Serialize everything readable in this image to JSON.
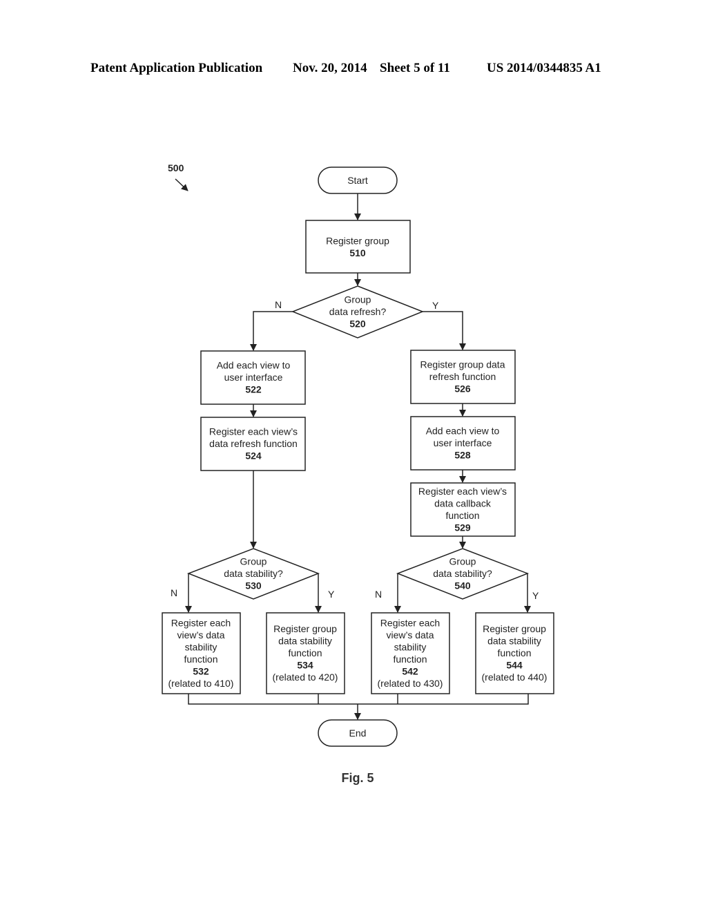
{
  "header": {
    "publication": "Patent Application Publication",
    "date": "Nov. 20, 2014",
    "sheet": "Sheet 5 of 11",
    "number": "US 2014/0344835 A1"
  },
  "diagram": {
    "ref_label": "500",
    "figure_caption": "Fig. 5",
    "start": "Start",
    "end": "End",
    "nodes": {
      "n510": {
        "lines": [
          "Register group"
        ],
        "num": "510"
      },
      "n520": {
        "lines": [
          "Group",
          "data refresh?"
        ],
        "num": "520"
      },
      "n522": {
        "lines": [
          "Add each view to",
          "user interface"
        ],
        "num": "522"
      },
      "n524": {
        "lines": [
          "Register each view’s",
          "data refresh function"
        ],
        "num": "524"
      },
      "n526": {
        "lines": [
          "Register group data",
          "refresh function"
        ],
        "num": "526"
      },
      "n528": {
        "lines": [
          "Add each view to",
          "user interface"
        ],
        "num": "528"
      },
      "n529": {
        "lines": [
          "Register each view’s",
          "data callback",
          "function"
        ],
        "num": "529"
      },
      "n530": {
        "lines": [
          "Group",
          "data stability?"
        ],
        "num": "530"
      },
      "n540": {
        "lines": [
          "Group",
          "data stability?"
        ],
        "num": "540"
      },
      "n532": {
        "lines": [
          "Register each",
          "view’s data",
          "stability",
          "function"
        ],
        "num": "532",
        "note": "(related to 410)"
      },
      "n534": {
        "lines": [
          "Register group",
          "data stability",
          "function"
        ],
        "num": "534",
        "note": "(related to 420)"
      },
      "n542": {
        "lines": [
          "Register each",
          "view’s data",
          "stability",
          "function"
        ],
        "num": "542",
        "note": "(related to 430)"
      },
      "n544": {
        "lines": [
          "Register group",
          "data stability",
          "function"
        ],
        "num": "544",
        "note": "(related to 440)"
      }
    },
    "branch_labels": {
      "no": "N",
      "yes": "Y"
    }
  }
}
